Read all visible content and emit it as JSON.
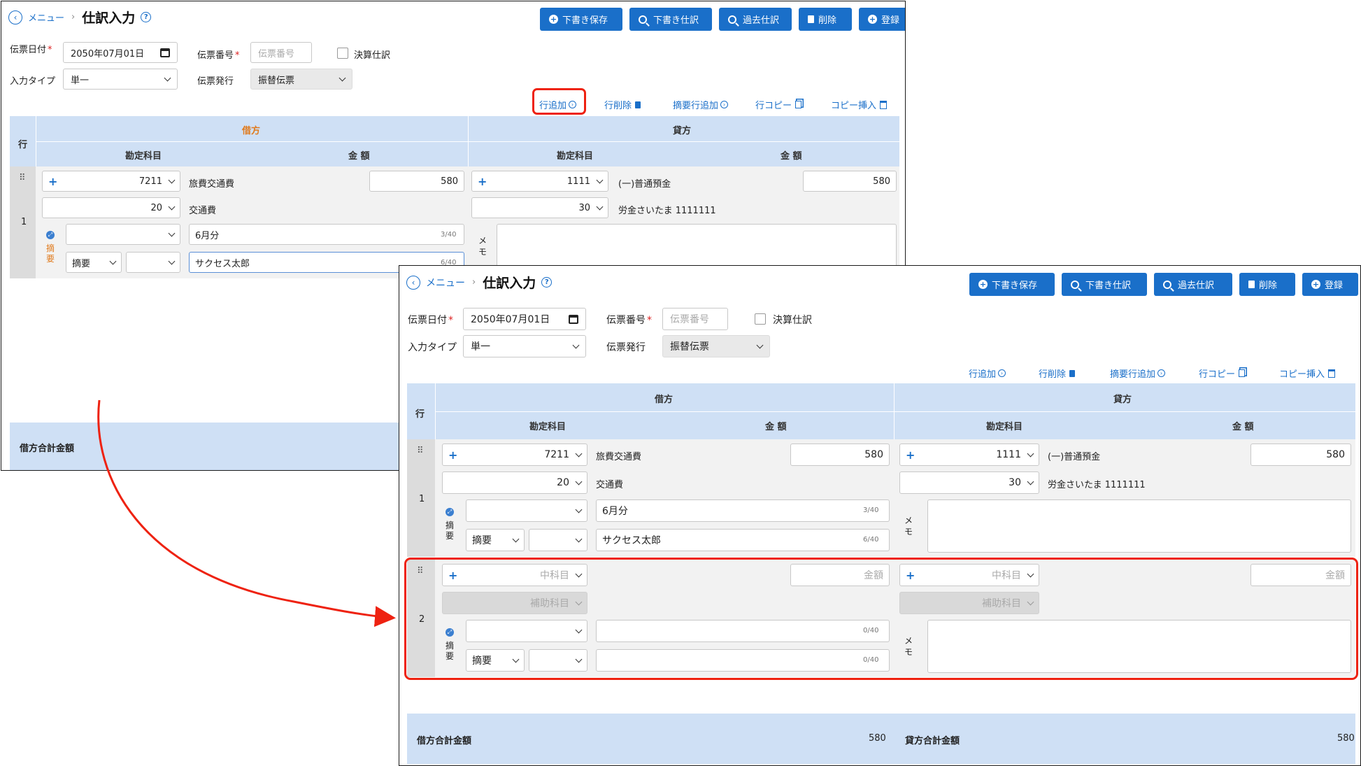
{
  "header": {
    "menu": "メニュー",
    "title": "仕訳入力"
  },
  "toolbar": {
    "save_draft": "下書き保存",
    "draft_journal": "下書き仕訳",
    "past_journal": "過去仕訳",
    "delete": "削除",
    "register": "登録"
  },
  "form": {
    "date_label": "伝票日付",
    "date_value": "2050年07月01日",
    "number_label": "伝票番号",
    "number_placeholder": "伝票番号",
    "closing_label": "決算仕訳",
    "input_type_label": "入力タイプ",
    "input_type_value": "単一",
    "issue_label": "伝票発行",
    "issue_value": "振替伝票"
  },
  "row_actions": {
    "add_row": "行追加",
    "delete_row": "行削除",
    "add_summary_row": "摘要行追加",
    "copy_row": "行コピー",
    "copy_insert": "コピー挿入"
  },
  "grid": {
    "row": "行",
    "debit": "借方",
    "credit": "貸方",
    "account": "勘定科目",
    "amount": "金 額"
  },
  "row1": {
    "num": "1",
    "debit_account": "7211",
    "debit_account_name": "旅費交通費",
    "debit_amount": "580",
    "debit_sub": "20",
    "debit_sub_name": "交通費",
    "credit_account": "1111",
    "credit_account_name": "(一)普通預金",
    "credit_amount": "580",
    "credit_sub": "30",
    "credit_sub_name": "労金さいたま 1111111",
    "summary1": "6月分",
    "summary1_count": "3/40",
    "summary2": "サクセス太郎",
    "summary2_count": "6/40",
    "summary_type": "摘要",
    "tekiyo": "摘要",
    "memo": "メモ"
  },
  "row2": {
    "num": "2",
    "account_placeholder": "中科目",
    "amount_placeholder": "金額",
    "sub_placeholder": "補助科目",
    "summary1_count": "0/40",
    "summary2_count": "0/40",
    "summary_type": "摘要"
  },
  "footer": {
    "debit_total_label": "借方合計金額",
    "debit_total": "580",
    "credit_total_label": "貸方合計金額",
    "credit_total": "580"
  },
  "colors": {
    "primary": "#1a6fc9",
    "highlight": "#e21111",
    "header_bg": "#cfe0f5",
    "debit_header_accent": "#e07a1c"
  }
}
